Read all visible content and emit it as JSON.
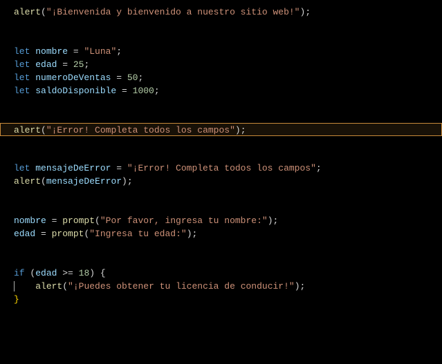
{
  "code": {
    "line1": {
      "fn": "alert",
      "open": "(",
      "str": "\"¡Bienvenida y bienvenido a nuestro sitio web!\"",
      "close": ")",
      "semi": ";"
    },
    "line4": {
      "kw": "let",
      "var": "nombre",
      "op": " = ",
      "str": "\"Luna\"",
      "semi": ";"
    },
    "line5": {
      "kw": "let",
      "var": "edad",
      "op": " = ",
      "num": "25",
      "semi": ";"
    },
    "line6": {
      "kw": "let",
      "var": "numeroDeVentas",
      "op": " = ",
      "num": "50",
      "semi": ";"
    },
    "line7": {
      "kw": "let",
      "var": "saldoDisponible",
      "op": " = ",
      "num": "1000",
      "semi": ";"
    },
    "line10": {
      "fn": "alert",
      "open": "(",
      "str": "\"¡Error! Completa todos los campos\"",
      "close": ")",
      "semi": ";"
    },
    "line13": {
      "kw": "let",
      "var": "mensajeDeError",
      "op": " = ",
      "str": "\"¡Error! Completa todos los campos\"",
      "semi": ";"
    },
    "line14": {
      "fn": "alert",
      "open": "(",
      "var": "mensajeDeError",
      "close": ")",
      "semi": ";"
    },
    "line17": {
      "var": "nombre",
      "op": " = ",
      "fn": "prompt",
      "open": "(",
      "str": "\"Por favor, ingresa tu nombre:\"",
      "close": ")",
      "semi": ";"
    },
    "line18": {
      "var": "edad",
      "op": " = ",
      "fn": "prompt",
      "open": "(",
      "str": "\"Ingresa tu edad:\"",
      "close": ")",
      "semi": ";"
    },
    "line21": {
      "kw": "if",
      "sp": " ",
      "open": "(",
      "var": "edad",
      "op": " >= ",
      "num": "18",
      "close": ")",
      "sp2": " ",
      "brace": "{"
    },
    "line22": {
      "indent": "    ",
      "fn": "alert",
      "open": "(",
      "str": "\"¡Puedes obtener tu licencia de conducir!\"",
      "close": ")",
      "semi": ";"
    },
    "line23": {
      "brace": "}"
    }
  }
}
